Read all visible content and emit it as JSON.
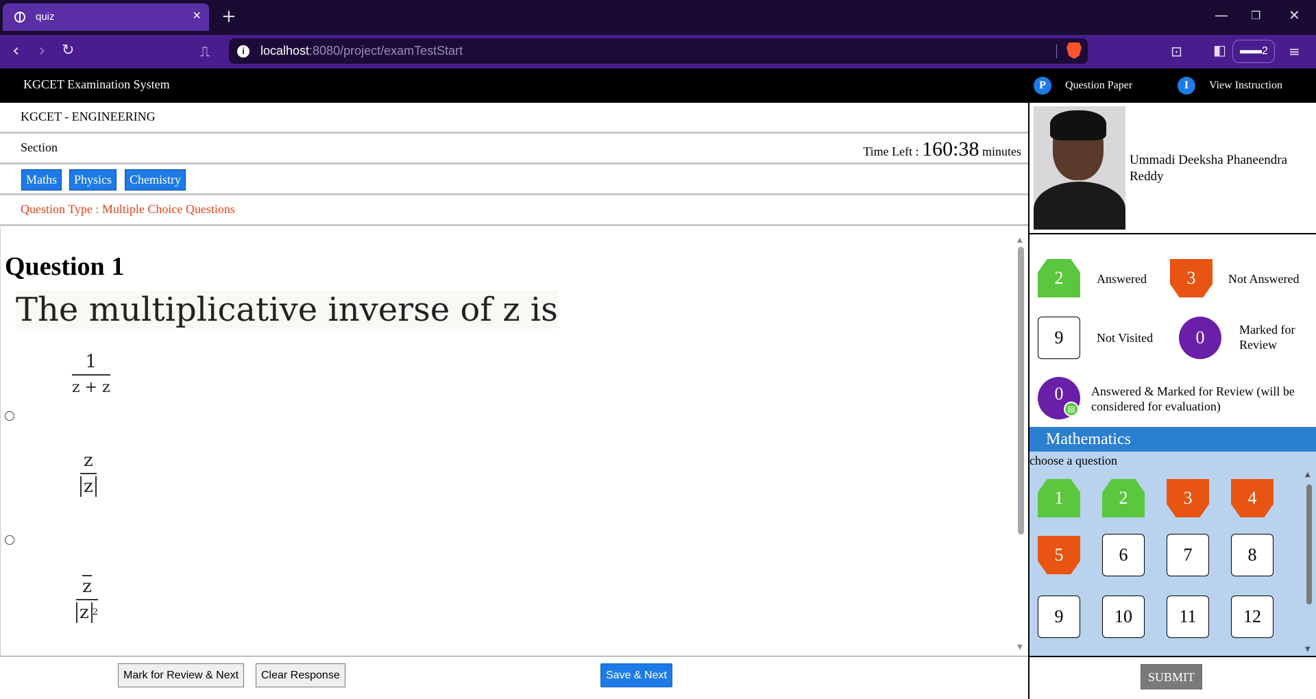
{
  "browser": {
    "tab_title": "quiz",
    "url_host": "localhost",
    "url_path": ":8080/project/examTestStart",
    "shields_count": "2"
  },
  "header": {
    "brand": "KGCET Examination System",
    "question_paper": {
      "letter": "P",
      "label": "Question Paper"
    },
    "view_instruction": {
      "letter": "I",
      "label": "View Instruction"
    }
  },
  "exam": {
    "name": "KGCET - ENGINEERING",
    "section_label": "Section",
    "time_left_label": "Time Left :",
    "time_left_value": "160:38",
    "time_left_unit": "minutes",
    "subjects": [
      "Maths",
      "Physics",
      "Chemistry"
    ],
    "question_type": "Question Type : Multiple Choice Questions"
  },
  "question": {
    "title": "Question 1",
    "text": "The multiplicative inverse of z is",
    "options": [
      {
        "num": "1",
        "den": "z + z"
      },
      {
        "num": "z",
        "den": "z"
      },
      {
        "num": "z",
        "den": "z",
        "den_power": "2"
      }
    ]
  },
  "footer": {
    "mark_review": "Mark for Review & Next",
    "clear": "Clear Response",
    "save_next": "Save & Next"
  },
  "candidate": {
    "name": "Ummadi Deeksha Phaneendra Reddy"
  },
  "legend": {
    "answered": {
      "count": "2",
      "label": "Answered"
    },
    "not_answered": {
      "count": "3",
      "label": "Not Answered"
    },
    "not_visited": {
      "count": "9",
      "label": "Not Visited"
    },
    "marked_review": {
      "count": "0",
      "label": "Marked for Review"
    },
    "answered_marked": {
      "count": "0",
      "label": "Answered & Marked for Review (will be considered for evaluation)"
    }
  },
  "palette": {
    "subject": "Mathematics",
    "choose_label": "choose a question",
    "questions": [
      {
        "n": "1",
        "status": "answered"
      },
      {
        "n": "2",
        "status": "answered"
      },
      {
        "n": "3",
        "status": "not-answered"
      },
      {
        "n": "4",
        "status": "not-answered"
      },
      {
        "n": "5",
        "status": "not-answered"
      },
      {
        "n": "6",
        "status": "not-visited"
      },
      {
        "n": "7",
        "status": "not-visited"
      },
      {
        "n": "8",
        "status": "not-visited"
      },
      {
        "n": "9",
        "status": "not-visited"
      },
      {
        "n": "10",
        "status": "not-visited"
      },
      {
        "n": "11",
        "status": "not-visited"
      },
      {
        "n": "12",
        "status": "not-visited"
      }
    ]
  },
  "submit_label": "SUBMIT",
  "colors": {
    "answered": "#5ac73e",
    "not_answered": "#e85412",
    "marked": "#6a1fa8",
    "primary": "#1e7ae6"
  }
}
